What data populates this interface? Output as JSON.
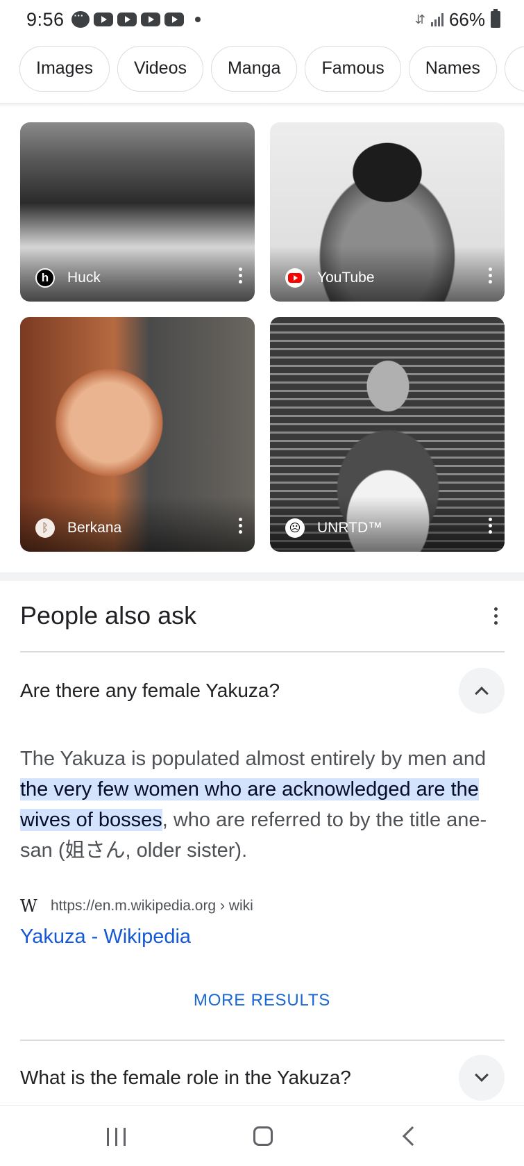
{
  "status_bar": {
    "time": "9:56",
    "battery": "66%"
  },
  "chips": [
    "Images",
    "Videos",
    "Manga",
    "Famous",
    "Names"
  ],
  "image_results": [
    {
      "source": "Huck",
      "icon": "huck-logo-icon"
    },
    {
      "source": "YouTube",
      "icon": "youtube-logo-icon"
    },
    {
      "source": "Berkana",
      "icon": "berkana-logo-icon"
    },
    {
      "source": "UNRTD™",
      "icon": "unrtd-logo-icon"
    }
  ],
  "people_also_ask": {
    "title": "People also ask",
    "questions": [
      {
        "text": "Are there any female Yakuza?",
        "expanded": true,
        "answer_before": "The Yakuza is populated almost entirely by men and ",
        "answer_highlight": "the very few women who are acknowledged are the wives of bosses",
        "answer_after": ", who are referred to by the title ane-san (姐さん, older sister).",
        "source_url": "https://en.m.wikipedia.org › wiki",
        "source_title": "Yakuza - Wikipedia",
        "more_label": "MORE RESULTS"
      },
      {
        "text": "What is the female role in the Yakuza?",
        "expanded": false
      }
    ]
  },
  "colors": {
    "highlight": "#d3e3fd",
    "link": "#1558d6",
    "more_results": "#1967d2"
  }
}
